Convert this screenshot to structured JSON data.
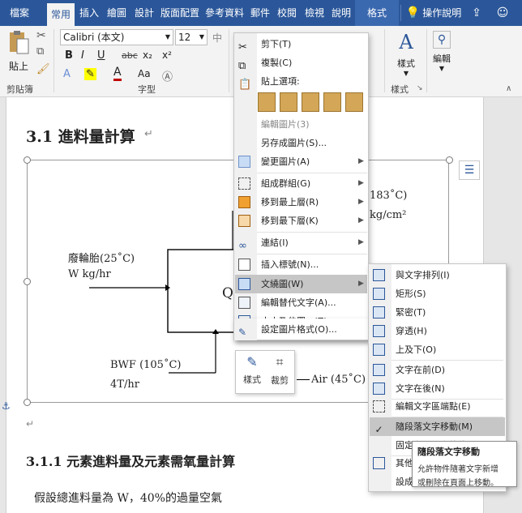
{
  "tabs": [
    {
      "label": "檔案"
    },
    {
      "label": "常用"
    },
    {
      "label": "插入"
    },
    {
      "label": "繪圖"
    },
    {
      "label": "設計"
    },
    {
      "label": "版面配置"
    },
    {
      "label": "參考資料"
    },
    {
      "label": "郵件"
    },
    {
      "label": "校閱"
    },
    {
      "label": "檢視"
    },
    {
      "label": "說明"
    },
    {
      "label": "格式"
    }
  ],
  "tell_me": "操作說明",
  "ribbon": {
    "paste": "貼上",
    "clipboard": "剪貼簿",
    "font_group": "字型",
    "font_name": "Calibri (本文)",
    "font_size": "12",
    "font_buttons": [
      "B",
      "I",
      "U",
      "abc",
      "x₂",
      "x²"
    ],
    "aa": "Aa",
    "styles": "樣式",
    "styles_group": "樣式",
    "editing": "編輯",
    "cjk_font": "中"
  },
  "document": {
    "heading1": "3.1 進料量計算",
    "heading2": "3.1.1 元素進料量及元素需氧量計算",
    "body_line": "假設總進料量為 W，40%的過量空氣",
    "diagram": {
      "tire_line1": "廢輪胎(25˚C)",
      "tire_line2": "W kg/hr",
      "box_letter": "Q",
      "temp_right": "183˚C)",
      "pressure_right": "kg/cm²",
      "bwf_line1": "BWF (105˚C)",
      "bwf_line2": "4T/hr",
      "air": "Air (45˚C)"
    }
  },
  "float_toolbar": {
    "style": "樣式",
    "crop": "裁剪"
  },
  "context_menu": {
    "items": [
      {
        "label": "剪下(T)",
        "icon": "scissors-icon",
        "submenu": false
      },
      {
        "label": "複製(C)",
        "icon": "copy-icon",
        "submenu": false
      },
      {
        "label": "貼上選項:",
        "icon": "paste-icon",
        "submenu": false
      },
      {
        "label": "編輯圖片(3)",
        "icon": "",
        "submenu": false
      },
      {
        "label": "另存成圖片(S)...",
        "icon": "",
        "submenu": false
      },
      {
        "label": "變更圖片(A)",
        "icon": "change-picture-icon",
        "submenu": true
      },
      {
        "label": "組成群組(G)",
        "icon": "group-icon",
        "submenu": true
      },
      {
        "label": "移到最上層(R)",
        "icon": "bring-front-icon",
        "submenu": true
      },
      {
        "label": "移到最下層(K)",
        "icon": "send-back-icon",
        "submenu": true
      },
      {
        "label": "連結(I)",
        "icon": "link-icon",
        "submenu": true
      },
      {
        "label": "插入標號(N)...",
        "icon": "caption-icon",
        "submenu": false
      },
      {
        "label": "文繞圖(W)",
        "icon": "wrap-text-icon",
        "submenu": true
      },
      {
        "label": "編輯替代文字(A)...",
        "icon": "alt-text-icon",
        "submenu": false
      },
      {
        "label": "大小及位置...(Z)",
        "icon": "size-position-icon",
        "submenu": false
      },
      {
        "label": "設定圖片格式(O)...",
        "icon": "format-picture-icon",
        "submenu": false
      }
    ]
  },
  "wrap_submenu": {
    "items": [
      {
        "label": "與文字排列(I)"
      },
      {
        "label": "矩形(S)"
      },
      {
        "label": "緊密(T)"
      },
      {
        "label": "穿透(H)"
      },
      {
        "label": "上及下(O)"
      },
      {
        "label": "文字在前(D)"
      },
      {
        "label": "文字在後(N)"
      },
      {
        "label": "編輯文字區端點(E)"
      },
      {
        "label": "隨段落文字移動(M)"
      },
      {
        "label": "固定在頁面上的位置(F)"
      },
      {
        "label": "其他版面配置選項(L)..."
      },
      {
        "label": "設成預設版面配置(A)"
      }
    ],
    "checked": "✓"
  },
  "tooltip": {
    "title": "隨段落文字移動",
    "desc1": "允許物件隨著文字新增",
    "desc2": "或刪除在頁面上移動。"
  },
  "colors": {
    "brand": "#2b579a",
    "highlight": "#c6c6c6",
    "font_red": "#c00000"
  }
}
